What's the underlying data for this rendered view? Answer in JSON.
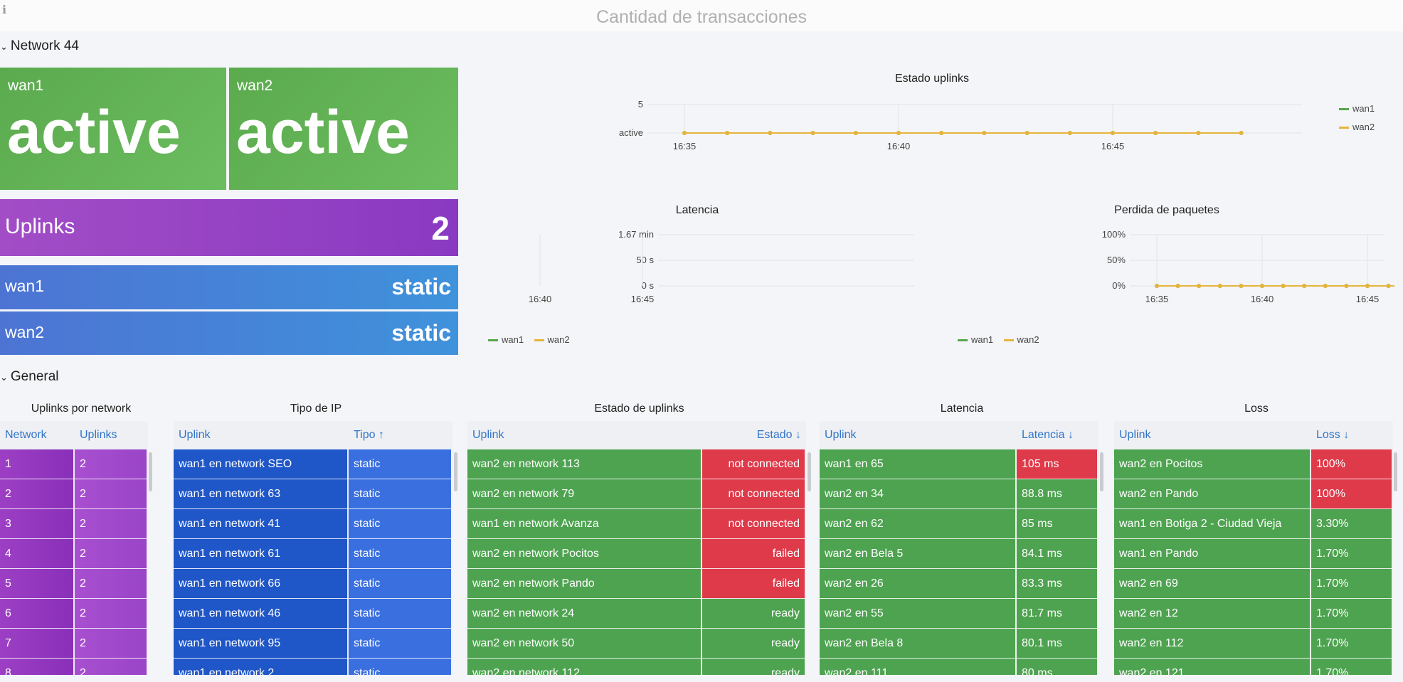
{
  "dashboard": {
    "title": "Cantidad de transacciones",
    "info_icon": "ℹ"
  },
  "rows": {
    "network": "Network 44",
    "general": "General"
  },
  "stats": {
    "wan1": {
      "label": "wan1",
      "value": "active"
    },
    "wan2": {
      "label": "wan2",
      "value": "active"
    },
    "uplinks": {
      "label": "Uplinks",
      "value": "2"
    },
    "wan1_type": {
      "label": "wan1",
      "value": "static"
    },
    "wan2_type": {
      "label": "wan2",
      "value": "static"
    }
  },
  "colors": {
    "wan1": "#56a64b",
    "wan2": "#e6b43c",
    "green": "#4ea350",
    "red": "#de3a4a",
    "purple": "#9c3fc4",
    "blue": "#1f56c8"
  },
  "chart_data": [
    {
      "type": "line",
      "title": "Estado uplinks",
      "x": [
        "16:34",
        "16:35",
        "16:36",
        "16:37",
        "16:38",
        "16:39",
        "16:40",
        "16:41",
        "16:42",
        "16:43",
        "16:44",
        "16:45",
        "16:46",
        "16:47"
      ],
      "x_ticks": [
        "16:35",
        "16:40",
        "16:45"
      ],
      "y_ticks": [
        "5",
        "active"
      ],
      "series": [
        {
          "name": "wan1",
          "values": [
            "active",
            "active",
            "active",
            "active",
            "active",
            "active",
            "active",
            "active",
            "active",
            "active",
            "active",
            "active",
            "active",
            "active"
          ]
        },
        {
          "name": "wan2",
          "values": [
            "active",
            "active",
            "active",
            "active",
            "active",
            "active",
            "active",
            "active",
            "active",
            "active",
            "active",
            "active",
            "active",
            "active"
          ]
        }
      ],
      "legend": "right"
    },
    {
      "type": "line",
      "title": "Latencia",
      "x_ticks": [
        "16:35",
        "16:40",
        "16:45"
      ],
      "y_ticks": [
        "1.67 min",
        "50 s",
        "0 s"
      ],
      "series": [
        {
          "name": "wan1",
          "values": []
        },
        {
          "name": "wan2",
          "values": []
        }
      ],
      "legend": "bottom"
    },
    {
      "type": "line",
      "title": "Perdida de paquetes",
      "x": [
        "16:34",
        "16:35",
        "16:36",
        "16:37",
        "16:38",
        "16:39",
        "16:40",
        "16:41",
        "16:42",
        "16:43",
        "16:44",
        "16:45",
        "16:46",
        "16:47"
      ],
      "x_ticks": [
        "16:35",
        "16:40",
        "16:45"
      ],
      "y_ticks": [
        "100%",
        "50%",
        "0%"
      ],
      "ylim": [
        0,
        100
      ],
      "series": [
        {
          "name": "wan1",
          "values": [
            0,
            0,
            0,
            0,
            0,
            0,
            0,
            0,
            0,
            0,
            0,
            0,
            0,
            0
          ]
        },
        {
          "name": "wan2",
          "values": [
            0,
            0,
            0,
            0,
            0,
            0,
            0,
            0,
            0,
            0,
            0,
            0,
            0,
            0
          ]
        }
      ],
      "legend": "bottom"
    }
  ],
  "tables": {
    "uplinks_por_network": {
      "title": "Uplinks por network",
      "headers": [
        "Network",
        "Uplinks"
      ],
      "rows": [
        [
          "1",
          "2"
        ],
        [
          "2",
          "2"
        ],
        [
          "3",
          "2"
        ],
        [
          "4",
          "2"
        ],
        [
          "5",
          "2"
        ],
        [
          "6",
          "2"
        ],
        [
          "7",
          "2"
        ],
        [
          "8",
          "2"
        ]
      ]
    },
    "tipo_ip": {
      "title": "Tipo de IP",
      "headers": [
        "Uplink",
        "Tipo ↑"
      ],
      "rows": [
        [
          "wan1 en network SEO",
          "static"
        ],
        [
          "wan1 en network 63",
          "static"
        ],
        [
          "wan1 en network 41",
          "static"
        ],
        [
          "wan1 en network 61",
          "static"
        ],
        [
          "wan1 en network 66",
          "static"
        ],
        [
          "wan1 en network 46",
          "static"
        ],
        [
          "wan1 en network 95",
          "static"
        ],
        [
          "wan1 en network 2",
          "static"
        ]
      ]
    },
    "estado_uplinks": {
      "title": "Estado de uplinks",
      "headers": [
        "Uplink",
        "Estado ↓"
      ],
      "rows": [
        [
          "wan2 en network 113",
          "not connected",
          "red"
        ],
        [
          "wan2 en network 79",
          "not connected",
          "red"
        ],
        [
          "wan1 en network Avanza",
          "not connected",
          "red"
        ],
        [
          "wan2 en network Pocitos",
          "failed",
          "red"
        ],
        [
          "wan2 en network Pando",
          "failed",
          "red"
        ],
        [
          "wan2 en network 24",
          "ready",
          "green"
        ],
        [
          "wan2 en network 50",
          "ready",
          "green"
        ],
        [
          "wan2 en network 112",
          "ready",
          "green"
        ]
      ]
    },
    "latencia": {
      "title": "Latencia",
      "headers": [
        "Uplink",
        "Latencia ↓"
      ],
      "rows": [
        [
          "wan1 en 65",
          "105 ms",
          "red"
        ],
        [
          "wan2 en 34",
          "88.8 ms",
          "green"
        ],
        [
          "wan2 en 62",
          "85 ms",
          "green"
        ],
        [
          "wan2 en Bela 5",
          "84.1 ms",
          "green"
        ],
        [
          "wan2 en 26",
          "83.3 ms",
          "green"
        ],
        [
          "wan2 en 55",
          "81.7 ms",
          "green"
        ],
        [
          "wan2 en Bela 8",
          "80.1 ms",
          "green"
        ],
        [
          "wan2 en 111",
          "80 ms",
          "green"
        ]
      ]
    },
    "loss": {
      "title": "Loss",
      "headers": [
        "Uplink",
        "Loss ↓"
      ],
      "rows": [
        [
          "wan2 en Pocitos",
          "100%",
          "red"
        ],
        [
          "wan2 en Pando",
          "100%",
          "red"
        ],
        [
          "wan1 en Botiga 2 - Ciudad Vieja",
          "3.30%",
          "green"
        ],
        [
          "wan1 en Pando",
          "1.70%",
          "green"
        ],
        [
          "wan2 en 69",
          "1.70%",
          "green"
        ],
        [
          "wan2 en 12",
          "1.70%",
          "green"
        ],
        [
          "wan2 en 112",
          "1.70%",
          "green"
        ],
        [
          "wan2 en 121",
          "1.70%",
          "green"
        ]
      ]
    }
  }
}
